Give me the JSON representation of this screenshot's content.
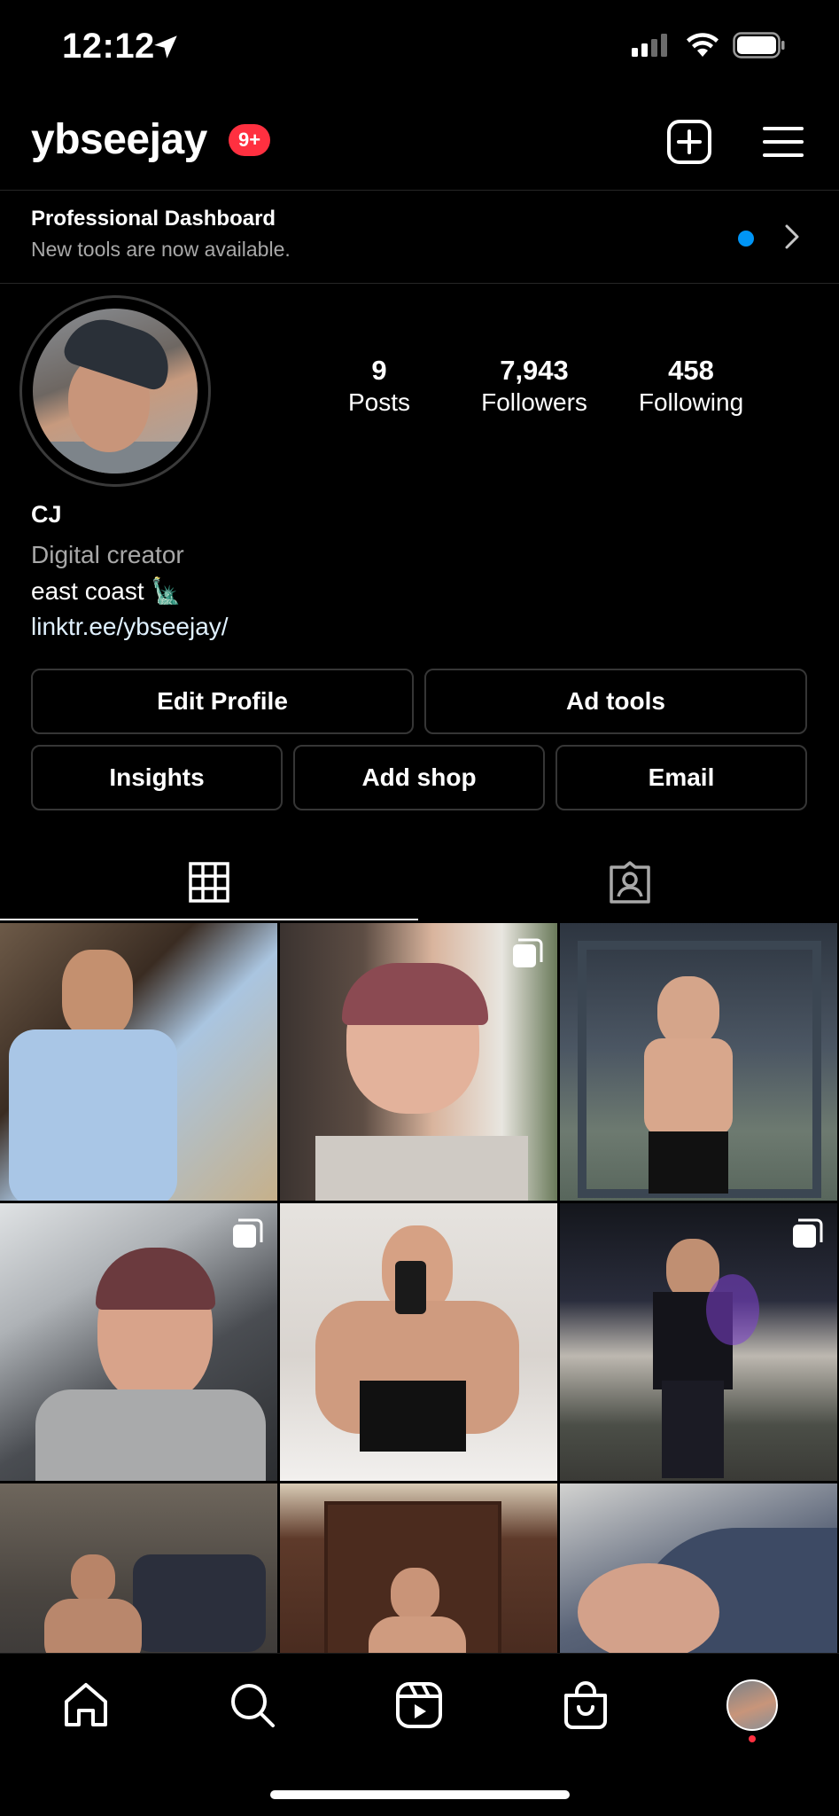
{
  "status_bar": {
    "time": "12:12"
  },
  "header": {
    "username": "ybseejay",
    "notification_badge": "9+",
    "create_icon": "plus-square-icon",
    "menu_icon": "hamburger-menu-icon"
  },
  "dashboard": {
    "title": "Professional Dashboard",
    "subtitle": "New tools are now available."
  },
  "profile": {
    "stats": [
      {
        "value": "9",
        "label": "Posts"
      },
      {
        "value": "7,943",
        "label": "Followers"
      },
      {
        "value": "458",
        "label": "Following"
      }
    ],
    "name": "CJ",
    "category": "Digital creator",
    "bio_line": "east coast 🗽",
    "link": "linktr.ee/ybseejay/"
  },
  "buttons": {
    "edit_profile": "Edit Profile",
    "ad_tools": "Ad tools",
    "insights": "Insights",
    "add_shop": "Add shop",
    "email": "Email"
  },
  "tabs": [
    {
      "icon": "grid-icon",
      "active": true
    },
    {
      "icon": "tagged-person-icon",
      "active": false
    }
  ],
  "posts": [
    {
      "multi": false
    },
    {
      "multi": true
    },
    {
      "multi": false
    },
    {
      "multi": true
    },
    {
      "multi": false
    },
    {
      "multi": true
    },
    {
      "multi": false
    },
    {
      "multi": false
    },
    {
      "multi": false
    }
  ],
  "bottom_nav": [
    "home-icon",
    "search-icon",
    "reels-icon",
    "shop-icon",
    "profile-avatar"
  ],
  "colors": {
    "accent_blue": "#0095f6",
    "badge_red": "#ff3040",
    "background": "#000000"
  }
}
